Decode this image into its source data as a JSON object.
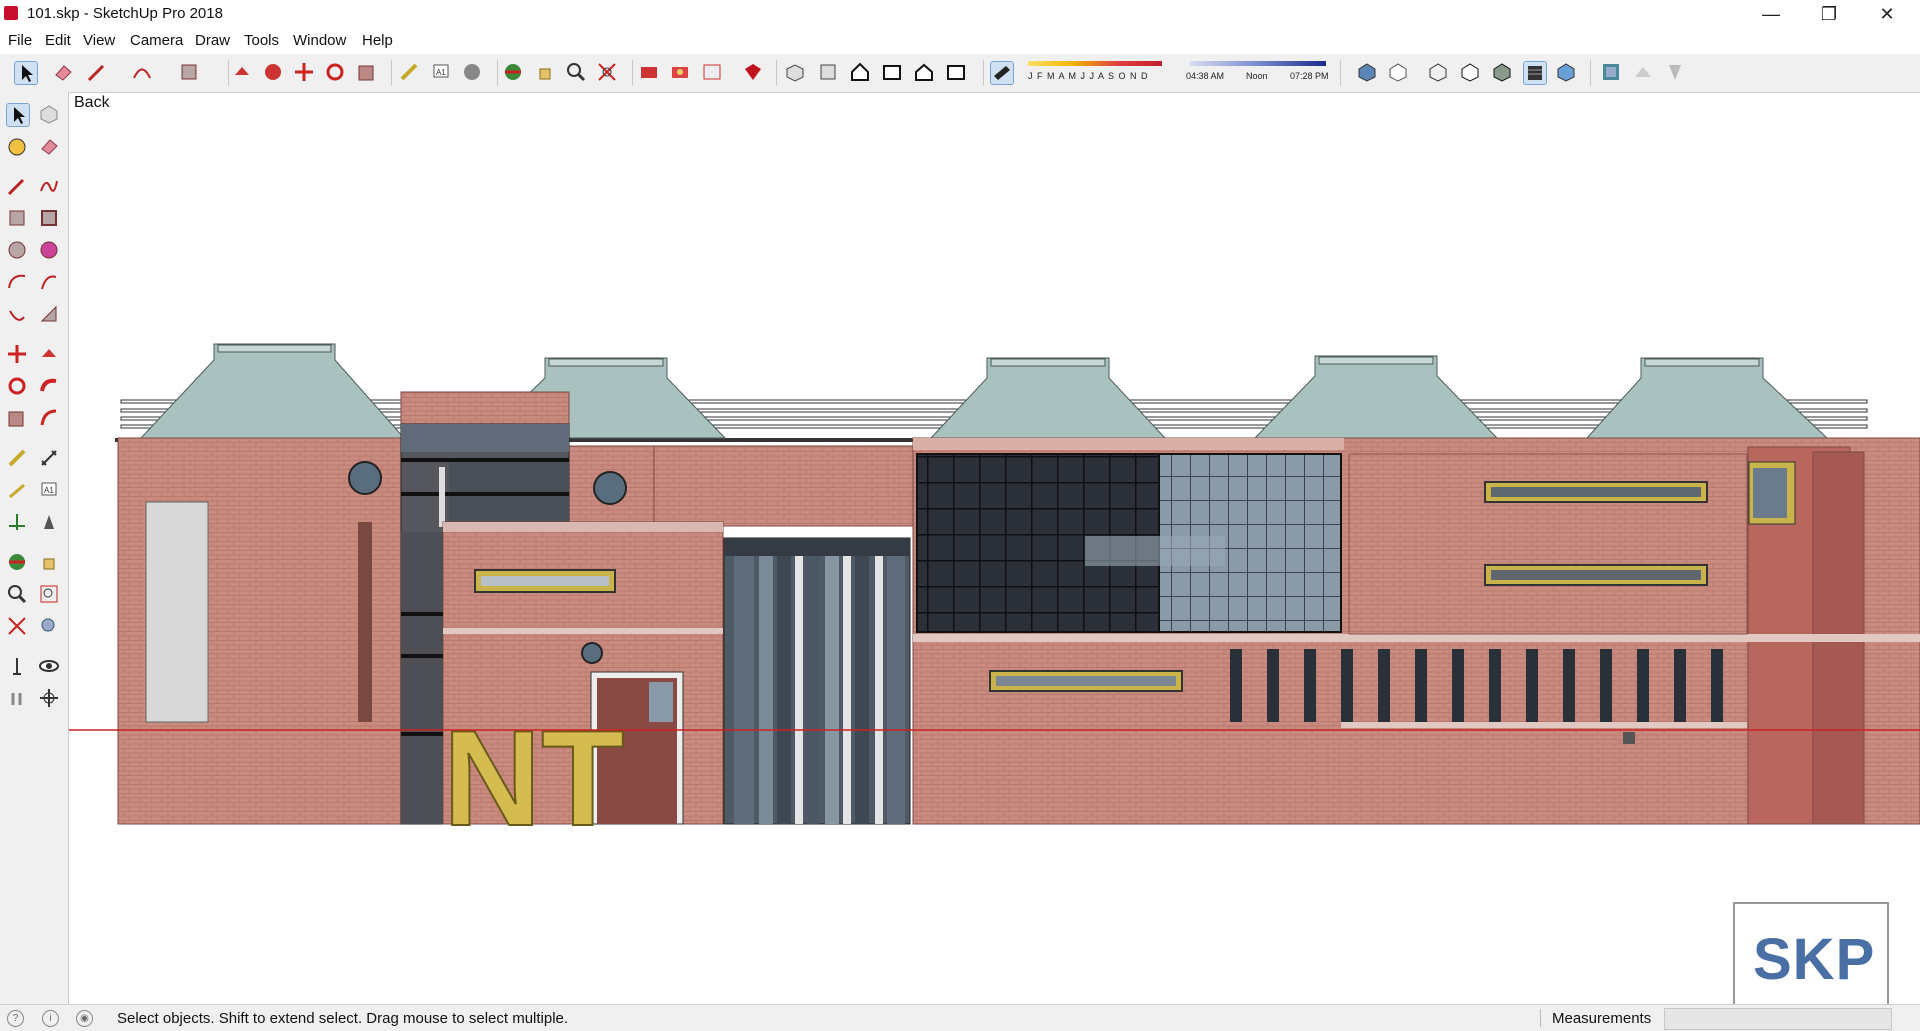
{
  "window": {
    "title": "101.skp - SketchUp Pro 2018",
    "minimize": "—",
    "maximize": "❐",
    "close": "✕"
  },
  "menu": [
    "File",
    "Edit",
    "View",
    "Camera",
    "Draw",
    "Tools",
    "Window",
    "Help"
  ],
  "toolbar": {
    "months": "J F M A M J J A S O N D",
    "time_start": "04:38 AM",
    "time_mid": "Noon",
    "time_end": "07:28 PM"
  },
  "viewport": {
    "scene_label": "Back",
    "building_sign": "NT"
  },
  "status": {
    "hint": "Select objects. Shift to extend select. Drag mouse to select multiple.",
    "measurements_label": "Measurements",
    "measurements_value": ""
  },
  "logo": {
    "text": "SKP"
  },
  "colors": {
    "brick": "#c98a7f",
    "glass_dark": "#2c3038",
    "glass_light": "#8b9aa8",
    "roof": "#a9c1bf",
    "accent_yellow": "#c8b44a",
    "ground_line": "#cc2222"
  }
}
